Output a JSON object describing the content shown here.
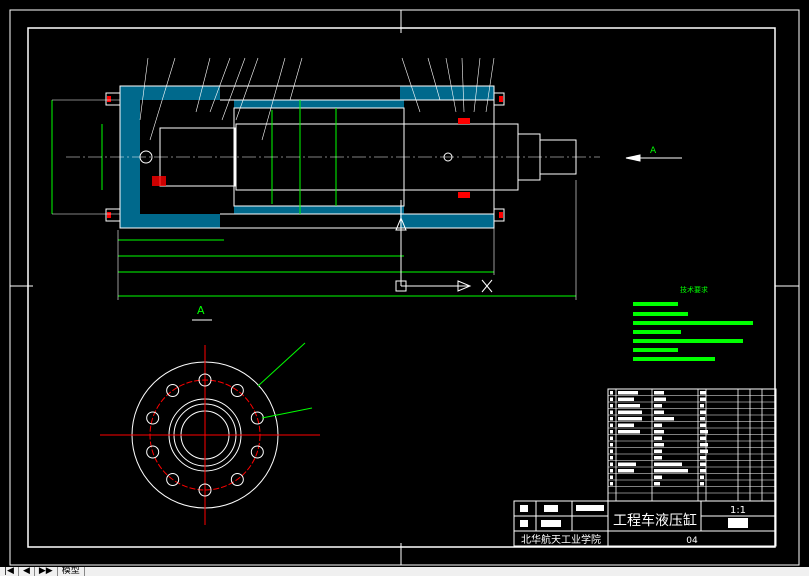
{
  "drawing": {
    "title": "工程车液压缸",
    "scale": "1:1",
    "school": "北华航天工业学院",
    "drawing_no": "04",
    "view_label": "A",
    "section_arrow_label": "A",
    "tech_req_title": "技术要求"
  },
  "tabs": {
    "model": "模型"
  },
  "colors": {
    "background": "#000000",
    "lines": "#ffffff",
    "red": "#ff0000",
    "green": "#00ff00",
    "hatch": "#00bfff",
    "yellow": "#ffff00"
  }
}
